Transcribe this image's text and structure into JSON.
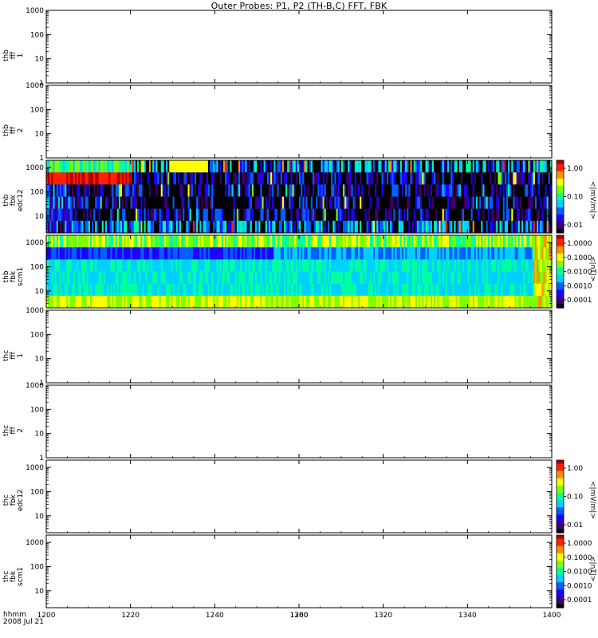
{
  "title": "Outer Probes: P1, P2 (TH-B,C) FFT, FBK",
  "x_axis": {
    "ticks": [
      "1200",
      "1220",
      "1240",
      "1260",
      "1300",
      "1320",
      "1340",
      "1400"
    ],
    "corner_label_1": "hhmm",
    "corner_label_2": "2008 Jul 21"
  },
  "colorbars": {
    "edc12": {
      "label": "<|mV/m|>",
      "ticks": [
        "1.00",
        "0.10",
        "0.01"
      ]
    },
    "scm1": {
      "label": "<|nT|>",
      "ticks": [
        "1.0000",
        "0.1000",
        "0.0100",
        "0.0010",
        "0.0001"
      ]
    }
  },
  "colors": {
    "jet": [
      "#000000",
      "#3b0070",
      "#1e00ff",
      "#0060ff",
      "#00d0ff",
      "#00ffa0",
      "#7cff00",
      "#ffff00",
      "#ff9000",
      "#ff2000",
      "#b00000"
    ]
  },
  "chart_data": {
    "type": "heatmap",
    "title": "Outer Probes: P1, P2 (TH-B,C) FFT, FBK",
    "x_ticks": [
      "1200",
      "1220",
      "1240",
      "1260",
      "1300",
      "1320",
      "1340",
      "1400"
    ],
    "panels": [
      {
        "id": "thb_fft1",
        "ylabel": [
          "thb",
          "fff",
          "1"
        ],
        "yticks": [
          "1000",
          "100",
          "10",
          "1"
        ],
        "ylim": [
          1,
          1000
        ],
        "has_data": false
      },
      {
        "id": "thb_fft2",
        "ylabel": [
          "thb",
          "fff",
          "2"
        ],
        "yticks": [
          "1000",
          "100",
          "10",
          "1"
        ],
        "ylim": [
          1,
          1000
        ],
        "has_data": false
      },
      {
        "id": "thb_fbk_edc12",
        "ylabel": [
          "thb",
          "fbk",
          "edc12"
        ],
        "yticks": [
          "1000",
          "100",
          "10"
        ],
        "has_data": true,
        "colorbar": "edc12",
        "bands": [
          {
            "from": 1200,
            "to": 1234,
            "value": 0.8
          },
          {
            "from": 1234,
            "to": 1400,
            "value": 0.01
          }
        ]
      },
      {
        "id": "thb_fbk_scm1",
        "ylabel": [
          "thb",
          "fbk",
          "scm1"
        ],
        "yticks": [
          "1000",
          "100",
          "10"
        ],
        "has_data": true,
        "colorbar": "scm1",
        "bands": [
          {
            "from": 1200,
            "to": 1400,
            "value": 0.005
          }
        ]
      },
      {
        "id": "thc_fft1",
        "ylabel": [
          "thc",
          "fff",
          "1"
        ],
        "yticks": [
          "1000",
          "100",
          "10",
          "1"
        ],
        "ylim": [
          1,
          1000
        ],
        "has_data": false
      },
      {
        "id": "thc_fft2",
        "ylabel": [
          "thc",
          "fff",
          "2"
        ],
        "yticks": [
          "1000",
          "100",
          "10",
          "1"
        ],
        "ylim": [
          1,
          1000
        ],
        "has_data": false
      },
      {
        "id": "thc_fbk_edc12",
        "ylabel": [
          "thc",
          "fbk",
          "edc12"
        ],
        "yticks": [
          "1000",
          "100",
          "10"
        ],
        "has_data": false,
        "colorbar": "edc12"
      },
      {
        "id": "thc_fbk_scm1",
        "ylabel": [
          "thc",
          "fbk",
          "scm1"
        ],
        "yticks": [
          "1000",
          "100",
          "10"
        ],
        "has_data": false,
        "colorbar": "scm1"
      }
    ]
  }
}
